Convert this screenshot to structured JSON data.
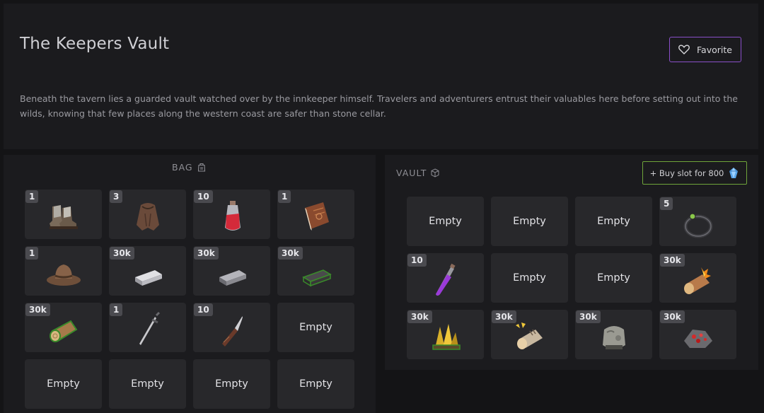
{
  "header": {
    "title": "The Keepers Vault",
    "favorite_label": "Favorite",
    "description": "Beneath the tavern lies a guarded vault watched over by the innkeeper himself. Travelers and adventurers entrust their valuables here before setting out into the wilds, knowing that few places along the western coast are safer than stone cellar."
  },
  "bag": {
    "title": "BAG",
    "slots": [
      {
        "count": "1",
        "item": "boots-icon"
      },
      {
        "count": "3",
        "item": "cloak-icon"
      },
      {
        "count": "10",
        "item": "red-potion-icon"
      },
      {
        "count": "1",
        "item": "book-icon"
      },
      {
        "count": "1",
        "item": "hat-icon"
      },
      {
        "count": "30k",
        "item": "silver-ingot-icon"
      },
      {
        "count": "30k",
        "item": "iron-ingot-icon"
      },
      {
        "count": "30k",
        "item": "dark-ingot-icon"
      },
      {
        "count": "30k",
        "item": "log-icon"
      },
      {
        "count": "1",
        "item": "sword-icon"
      },
      {
        "count": "10",
        "item": "knife-icon"
      },
      {
        "empty": "Empty"
      },
      {
        "empty": "Empty"
      },
      {
        "empty": "Empty"
      },
      {
        "empty": "Empty"
      },
      {
        "empty": "Empty"
      }
    ]
  },
  "vault": {
    "title": "VAULT",
    "buy_label": "+ Buy slot for 800",
    "slots": [
      {
        "empty": "Empty"
      },
      {
        "empty": "Empty"
      },
      {
        "empty": "Empty"
      },
      {
        "count": "5",
        "item": "ring-icon"
      },
      {
        "count": "10",
        "item": "purple-vial-icon"
      },
      {
        "empty": "Empty"
      },
      {
        "empty": "Empty"
      },
      {
        "count": "30k",
        "item": "burning-log-icon"
      },
      {
        "count": "30k",
        "item": "gold-crystal-icon"
      },
      {
        "count": "30k",
        "item": "sparked-log-icon"
      },
      {
        "count": "30k",
        "item": "stone-icon"
      },
      {
        "count": "30k",
        "item": "red-ore-icon"
      }
    ]
  }
}
